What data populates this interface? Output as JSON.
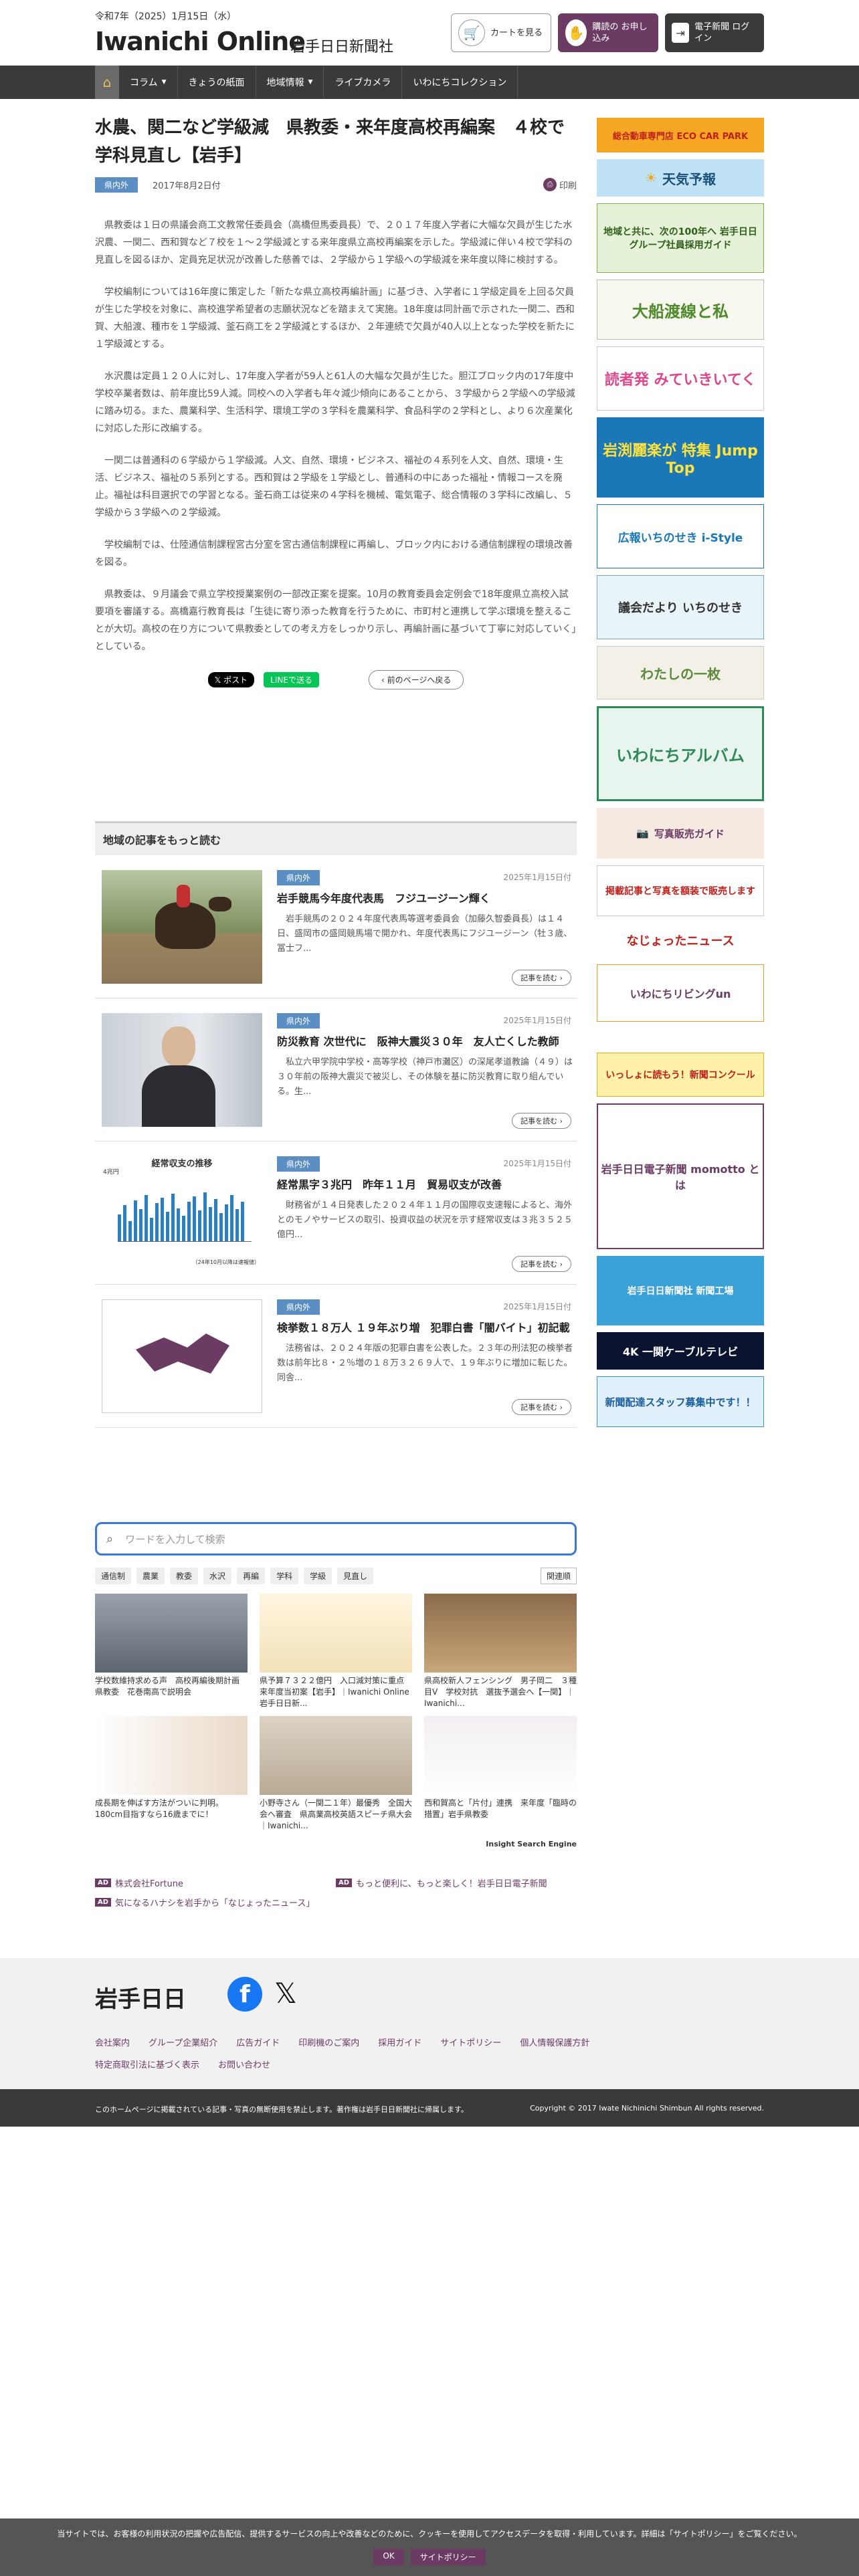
{
  "header": {
    "date": "令和7年（2025）1月15日（水）",
    "logo": "Iwanichi Online",
    "logo_sub": "岩手日日新聞社",
    "cart": "カートを見る",
    "subscribe": "購読の お申し込み",
    "login": "電子新聞 ログイン"
  },
  "nav": {
    "items": [
      "コラム",
      "きょうの紙面",
      "地域情報",
      "ライブカメラ",
      "いわにちコレクション"
    ]
  },
  "article": {
    "title": "水農、関二など学級減　県教委・来年度高校再編案　４校で学科見直し【岩手】",
    "badge": "県内外",
    "date": "2017年8月2日付",
    "print": "印刷",
    "paragraphs": [
      "県教委は１日の県議会商工文教常任委員会（高橋但馬委員長）で、２０１７年度入学者に大幅な欠員が生じた水沢農、一関二、西和賀など７校を１～２学級減とする来年度県立高校再編案を示した。学級減に伴い４校で学科の見直しを図るほか、定員充足状況が改善した慈善では、２学級から１学級への学級減を来年度以降に検討する。",
      "学校編制については16年度に策定した「新たな県立高校再編計画」に基づき、入学者に１学級定員を上回る欠員が生じた学校を対象に、高校進学希望者の志願状況などを踏まえて実施。18年度は同計画で示された一関二、西和賀、大船渡、種市を１学級減、釜石商工を２学級減とするほか、２年連続で欠員が40人以上となった学校を新たに１学級減とする。",
      "水沢農は定員１２０人に対し、17年度入学者が59人と61人の大幅な欠員が生じた。胆江ブロック内の17年度中学校卒業者数は、前年度比59人減。同校への入学者も年々減少傾向にあることから、３学級から２学級への学級減に踏み切る。また、農業科学、生活科学、環境工学の３学科を農業科学、食品科学の２学科とし、より６次産業化に対応した形に改編する。",
      "一関二は普通科の６学級から１学級減。人文、自然、環境・ビジネス、福祉の４系列を人文、自然、環境・生活、ビジネス、福祉の５系列とする。西和賀は２学級を１学級とし、普通科の中にあった福祉・情報コースを廃止。福祉は科目選択での学習となる。釜石商工は従来の４学科を機械、電気電子、総合情報の３学科に改編し、５学級から３学級への２学級減。",
      "学校編制では、仕陸通信制課程宮古分室を宮古通信制課程に再編し、ブロック内における通信制課程の環境改善を図る。",
      "県教委は、９月議会で県立学校授業案例の一部改正案を提案。10月の教育委員会定例会で18年度県立高校入試要項を審議する。高橋嘉行教育長は「生徒に寄り添った教育を行うために、市町村と連携して学ぶ環境を整えることが大切。高校の在り方について県教委としての考え方をしっかり示し、再編計画に基づいて丁寧に対応していく」としている。"
    ],
    "share_x": "ポスト",
    "share_line": "LINEで送る",
    "back": "前のページへ戻る"
  },
  "more": {
    "heading": "地域の記事をもっと読む",
    "cards": [
      {
        "badge": "県内外",
        "date": "2025年1月15日付",
        "title": "岩手競馬今年度代表馬　フジユージーン輝く",
        "excerpt": "岩手競馬の２０２４年度代表馬等選考委員会（加藤久智委員長）は１４日、盛岡市の盛岡競馬場で開かれ、年度代表馬にフジユージーン（牡３歳、冨士フ...",
        "more": "記事を読む"
      },
      {
        "badge": "県内外",
        "date": "2025年1月15日付",
        "title": "防災教育 次世代に　阪神大震災３０年　友人亡くした教師",
        "excerpt": "私立六甲学院中学校・高等学校（神戸市灘区）の深尾孝道教論（４９）は３０年前の阪神大震災で被災し、その体験を基に防災教育に取り組んでいる。生...",
        "more": "記事を読む"
      },
      {
        "badge": "県内外",
        "date": "2025年1月15日付",
        "title": "経常黒字３兆円　昨年１１月　貿易収支が改善",
        "excerpt": "財務省が１４日発表した２０２４年１１月の国際収支速報によると、海外とのモノやサービスの取引、投資収益の状況を示す経常収支は３兆３５２５億円...",
        "more": "記事を読む"
      },
      {
        "badge": "県内外",
        "date": "2025年1月15日付",
        "title": "検挙数１８万人 １９年ぶり増　犯罪白書「闇バイト」初記載",
        "excerpt": "法務省は、２０２４年版の犯罪白書を公表した。２３年の刑法犯の検挙者数は前年比８・２％増の１８万３２６９人で、１９年ぶりに増加に転じた。同舎...",
        "more": "記事を読む"
      }
    ],
    "chart_title": "経常収支の推移",
    "chart_unit": "4兆円",
    "chart_note": "（24年10月以降は速報値）"
  },
  "search": {
    "placeholder": "ワードを入力して検索",
    "tags": [
      "通信制",
      "農業",
      "教委",
      "水沢",
      "再編",
      "学科",
      "学級",
      "見直し"
    ],
    "sort": "関連順",
    "results": [
      "学校数維持求める声　高校再編後期計画　県教委　花巻南高で説明会",
      "県予算７３２２億円　入口減対策に重点　来年度当初案【岩手】｜Iwanichi Online 岩手日日新...",
      "県高校新人フェンシング　男子岡二　３種目V　学校対抗　選抜予選会へ【一関】｜Iwanichi...",
      "成長期を伸ばす方法がついに判明。180cm目指すなら16歳までに！",
      "小野寺さん（一関二１年）最優秀　全国大会へ審査　県高業高校英語スピーチ県大会｜Iwanichi...",
      "西和賀高と「片付」連携　来年度「臨時の措置」岩手県教委"
    ],
    "brand": "Insight Search Engine"
  },
  "ads": [
    "株式会社Fortune",
    "もっと便利に、もっと楽しく！岩手日日電子新聞",
    "気になるハナシを岩手から「なじょったニュース」"
  ],
  "sidebar": [
    "総合動車専門店 ECO CAR PARK",
    "天気予報",
    "地域と共に、次の100年へ 岩手日日グループ社員採用ガイド",
    "大船渡線と私",
    "読者発 みていきいてく",
    "岩渕麗楽が 特集 Jump Top",
    "広報いちのせき i-Style",
    "議会だより いちのせき",
    "わたしの一枚",
    "いわにちアルバム",
    "写真販売ガイド",
    "掲載記事と写真を額装で販売します",
    "なじょったニュース",
    "いわにちリビングun",
    "いっしょに読もう！新聞コンクール",
    "岩手日日電子新聞 momotto とは",
    "岩手日日新聞社 新聞工場",
    "4K 一関ケーブルテレビ",
    "新聞配達スタッフ募集中です！！"
  ],
  "footer": {
    "logo": "岩手日日",
    "links": [
      "会社案内",
      "グループ企業紹介",
      "広告ガイド",
      "印刷機のご案内",
      "採用ガイド",
      "サイトポリシー",
      "個人情報保護方針",
      "特定商取引法に基づく表示",
      "お問い合わせ"
    ],
    "notice": "このホームページに掲載されている記事・写真の無断使用を禁止します。著作権は岩手日日新聞社に帰属します。",
    "copyright": "Copyright © 2017 Iwate Nichinichi Shimbun All rights reserved."
  },
  "cookie": {
    "text": "当サイトでは、お客様の利用状況の把握や広告配信、提供するサービスの向上や改善などのために、クッキーを使用してアクセスデータを取得・利用しています。詳細は「サイトポリシー」をご覧ください。",
    "ok": "OK",
    "policy": "サイトポリシー"
  },
  "colors": {
    "accent": "#6b3b63",
    "nav": "#3a3a3a",
    "badge": "#5b8fc4",
    "search": "#3a78d8"
  }
}
